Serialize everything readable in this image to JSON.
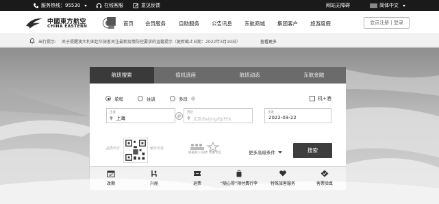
{
  "topbar": {
    "hotline": "服务热线：95530",
    "online_service": "在线客服",
    "feedback": "意见反馈",
    "accessibility": "网站无障碍",
    "language": "简体中文"
  },
  "header": {
    "logo_cn": "中國東方航空",
    "logo_en": "CHINA EASTERN",
    "nav": [
      "首页",
      "会员服务",
      "自助服务",
      "公告讯息",
      "东航商城",
      "集团客户",
      "旅游度假"
    ],
    "member_link": "会员注册 | 登录"
  },
  "notice": {
    "label": "出行提示:",
    "text": "关于提醒澳大利亚赴华旅客关注最新疫情防控要求的温馨提示（更新截止日期：2022年3月19日）",
    "more": "查看更多"
  },
  "booking": {
    "tabs": [
      "航班搜索",
      "值机选座",
      "航班动态",
      "东航金融"
    ],
    "trip_types": [
      "单程",
      "往返",
      "多段"
    ],
    "selected_trip": "单程",
    "checkbox_label": "机+酒",
    "from": {
      "label": "出发",
      "value": "上海"
    },
    "to": {
      "label": "到达",
      "placeholder": "北京/Beijing/BJ/PEK"
    },
    "date": {
      "label": "出发",
      "value": "2022-03-22"
    },
    "qr_left": "品质出行",
    "qr_right": "触手可及",
    "promo_text": "搭载家人/同伴 优惠专区",
    "more_options": "更多高级条件",
    "search_button": "搜索"
  },
  "services": [
    {
      "label": "改期",
      "icon": "calendar-icon"
    },
    {
      "label": "升舱",
      "icon": "seat-upgrade-icon"
    },
    {
      "label": "退票",
      "icon": "ticket-icon"
    },
    {
      "label": "“随心带”预付费行李",
      "icon": "luggage-icon"
    },
    {
      "label": "特殊旅客服务",
      "icon": "heart-hand-icon"
    },
    {
      "label": "客票验真",
      "icon": "verify-icon"
    }
  ],
  "colors": {
    "topbar_bg": "#1a1a1a",
    "tab_active": "#3a3a3a",
    "tab_bg": "#6b6b6b",
    "search_button": "#3d3d3d"
  }
}
